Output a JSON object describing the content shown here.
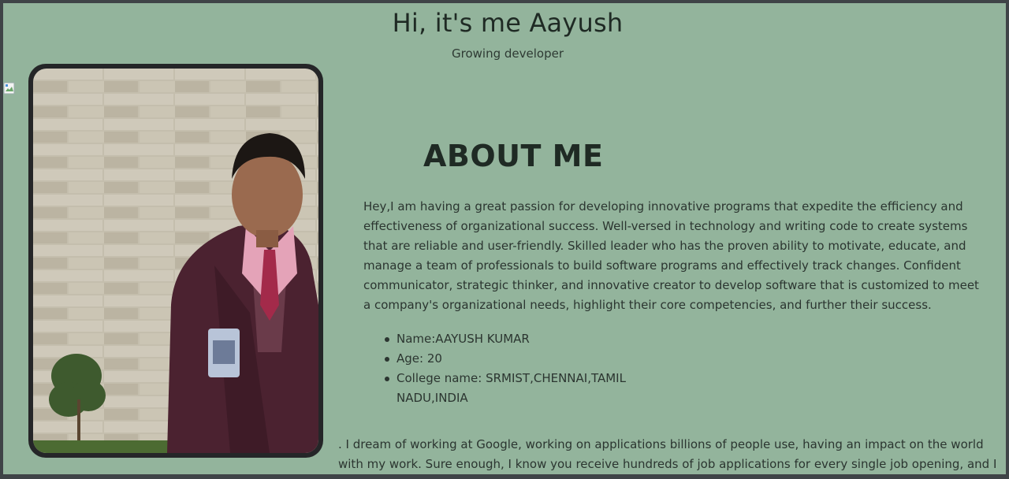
{
  "header": {
    "title": "Hi, it's me Aayush",
    "subtitle": "Growing developer"
  },
  "about": {
    "heading": "ABOUT ME",
    "paragraph": "Hey,I am having a great passion for developing innovative programs that expedite the efficiency and effectiveness of organizational success. Well-versed in technology and writing code to create systems that are reliable and user-friendly. Skilled leader who has the proven ability to motivate, educate, and manage a team of professionals to build software programs and effectively track changes. Confident communicator, strategic thinker, and innovative creator to develop software that is customized to meet a company's organizational needs, highlight their core competencies, and further their success.",
    "facts": [
      "Name:AAYUSH KUMAR",
      "Age: 20",
      "College name: SRMIST,CHENNAI,TAMIL NADU,INDIA"
    ],
    "dream": ". I dream of working at Google, working on applications billions of people use, having an impact on the world with my work. Sure enough, I know you receive hundreds of job applications for every single job opening, and I"
  },
  "colors": {
    "page_background": "#93b49c",
    "photo_frame": "#252628"
  },
  "icons": {
    "broken_image": "broken-image-icon"
  }
}
